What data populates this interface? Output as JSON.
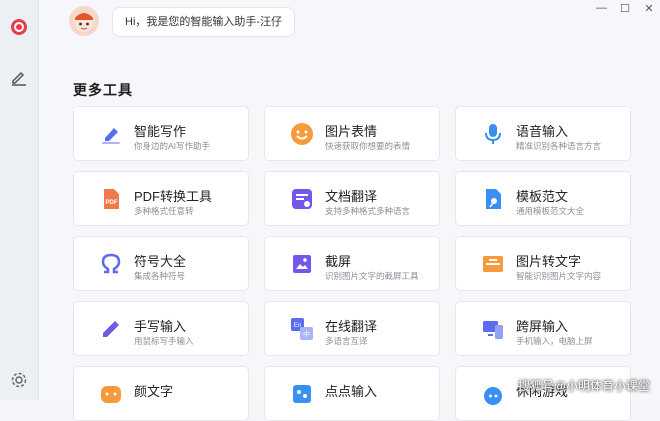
{
  "greeting": "Hi，我是您的智能输入助手-汪仔",
  "section_title": "更多工具",
  "watermark": "搜狐号@小明体育小课堂",
  "window_controls": {
    "minimize": "—",
    "maximize": "☐",
    "close": "✕"
  },
  "sidebar": [
    {
      "icon": "target-icon"
    },
    {
      "icon": "edit-icon"
    },
    {
      "icon": "gear-icon"
    }
  ],
  "tools": [
    {
      "title": "智能写作",
      "desc": "你身边的AI写作助手",
      "icon": "pen-icon",
      "color": "#5b6cf2"
    },
    {
      "title": "图片表情",
      "desc": "快速获取你想要的表情",
      "icon": "smile-icon",
      "color": "#f79a3e"
    },
    {
      "title": "语音输入",
      "desc": "精准识别各种语言方言",
      "icon": "microphone-icon",
      "color": "#3b8ff0"
    },
    {
      "title": "PDF转换工具",
      "desc": "多种格式任意转",
      "icon": "pdf-icon",
      "color": "#f07a4a"
    },
    {
      "title": "文档翻译",
      "desc": "支持多种格式多种语言",
      "icon": "translate-doc-icon",
      "color": "#7357e8"
    },
    {
      "title": "模板范文",
      "desc": "通用模板范文大全",
      "icon": "template-icon",
      "color": "#3b8ff0"
    },
    {
      "title": "符号大全",
      "desc": "集成各种符号",
      "icon": "omega-icon",
      "color": "#5b6cf2"
    },
    {
      "title": "截屏",
      "desc": "识别图片文字的截屏工具",
      "icon": "screenshot-icon",
      "color": "#7357e8"
    },
    {
      "title": "图片转文字",
      "desc": "智能识别图片文字内容",
      "icon": "image-text-icon",
      "color": "#f79a3e"
    },
    {
      "title": "手写输入",
      "desc": "用鼠标写手输入",
      "icon": "handwrite-icon",
      "color": "#7357e8"
    },
    {
      "title": "在线翻译",
      "desc": "多语言互译",
      "icon": "translate-icon",
      "color": "#5b6cf2"
    },
    {
      "title": "跨屏输入",
      "desc": "手机输入，电脑上屏",
      "icon": "cross-screen-icon",
      "color": "#5b6cf2"
    },
    {
      "title": "颜文字",
      "desc": "",
      "icon": "emoticon-icon",
      "color": "#f79a3e"
    },
    {
      "title": "点点输入",
      "desc": "",
      "icon": "dot-input-icon",
      "color": "#3b8ff0"
    },
    {
      "title": "休闲游戏",
      "desc": "",
      "icon": "game-icon",
      "color": "#3b8ff0"
    }
  ]
}
